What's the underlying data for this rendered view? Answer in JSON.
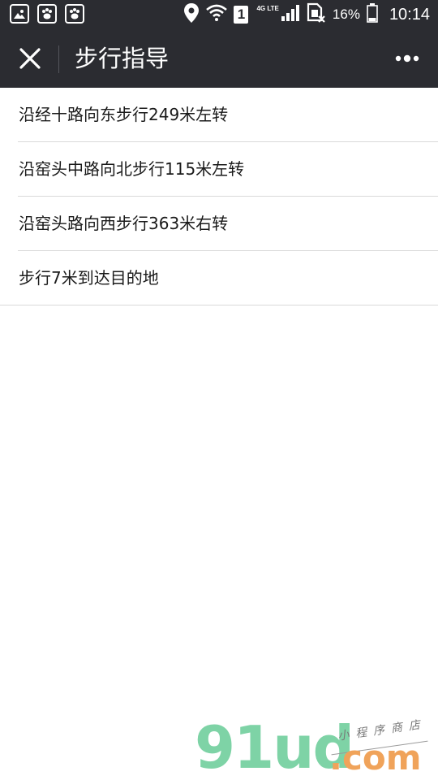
{
  "status_bar": {
    "network_type": "4G LTE",
    "sim_slot": "1",
    "battery_percent": "16%",
    "time": "10:14",
    "icons": [
      "gallery-icon",
      "baidu-paw-icon",
      "baidu-paw-icon",
      "location-pin-icon",
      "wifi-icon",
      "signal-icon",
      "no-sim-icon",
      "battery-icon"
    ]
  },
  "nav": {
    "title": "步行指导",
    "close_icon": "close-icon",
    "more_icon": "more-dots-icon"
  },
  "steps": [
    "沿经十路向东步行249米左转",
    "沿窑头中路向北步行115米左转",
    "沿窑头路向西步行363米右转",
    "步行7米到达目的地"
  ],
  "watermark": {
    "logo": "91ud",
    "domain": ".com",
    "tagline": "小程序商店"
  },
  "colors": {
    "header_bg": "#2b2c31",
    "divider": "#d9d9d9",
    "text": "#1a1a1a",
    "watermark_green": "#7ed3a6",
    "watermark_orange": "#f0a35a"
  }
}
